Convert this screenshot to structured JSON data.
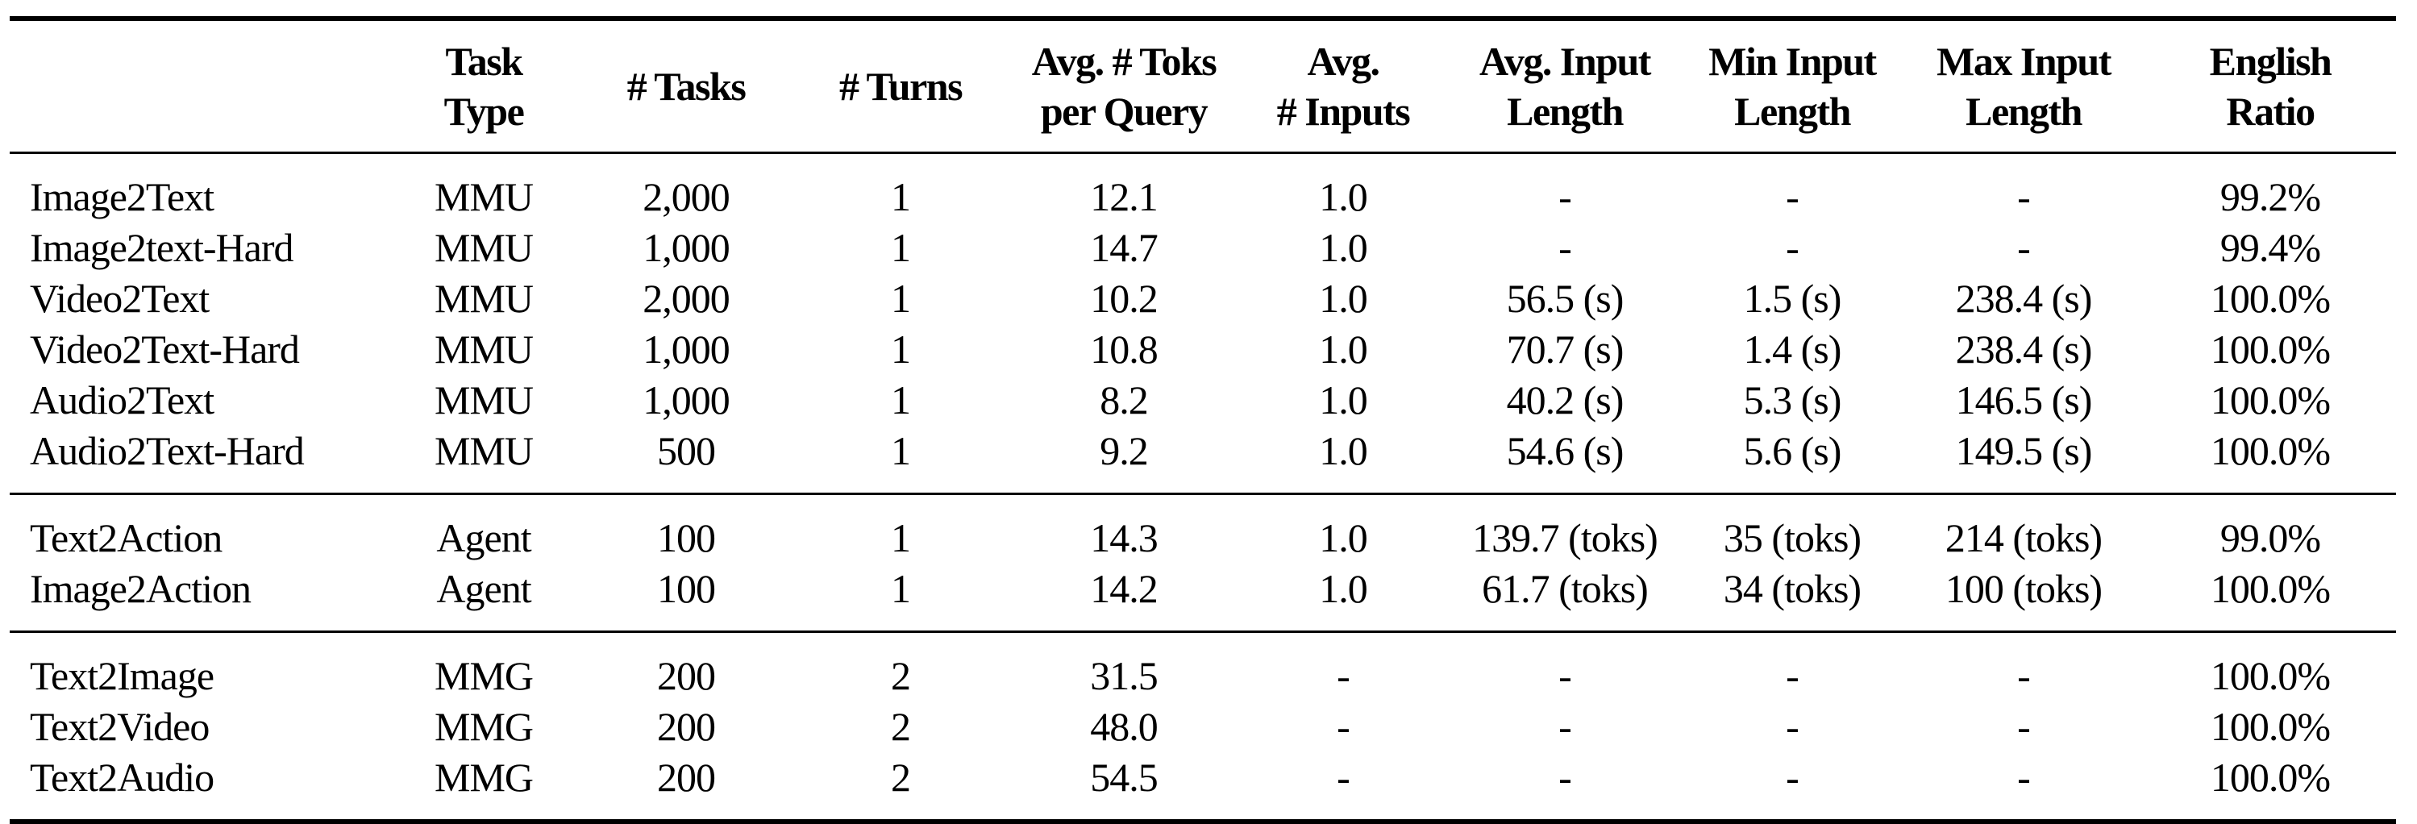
{
  "table": {
    "headers": [
      {
        "key": "name",
        "lines": [
          "",
          ""
        ]
      },
      {
        "key": "task_type",
        "lines": [
          "Task",
          "Type"
        ]
      },
      {
        "key": "num_tasks",
        "lines": [
          "# Tasks",
          ""
        ]
      },
      {
        "key": "num_turns",
        "lines": [
          "# Turns",
          ""
        ]
      },
      {
        "key": "avg_toks_per_query",
        "lines": [
          "Avg. # Toks",
          "per Query"
        ]
      },
      {
        "key": "avg_num_inputs",
        "lines": [
          "Avg.",
          "# Inputs"
        ]
      },
      {
        "key": "avg_input_length",
        "lines": [
          "Avg. Input",
          "Length"
        ]
      },
      {
        "key": "min_input_length",
        "lines": [
          "Min Input",
          "Length"
        ]
      },
      {
        "key": "max_input_length",
        "lines": [
          "Max Input",
          "Length"
        ]
      },
      {
        "key": "english_ratio",
        "lines": [
          "English",
          "Ratio"
        ]
      }
    ],
    "groups": [
      {
        "rows": [
          [
            "Image2Text",
            "MMU",
            "2,000",
            "1",
            "12.1",
            "1.0",
            "-",
            "-",
            "-",
            "99.2%"
          ],
          [
            "Image2text-Hard",
            "MMU",
            "1,000",
            "1",
            "14.7",
            "1.0",
            "-",
            "-",
            "-",
            "99.4%"
          ],
          [
            "Video2Text",
            "MMU",
            "2,000",
            "1",
            "10.2",
            "1.0",
            "56.5 (s)",
            "1.5 (s)",
            "238.4 (s)",
            "100.0%"
          ],
          [
            "Video2Text-Hard",
            "MMU",
            "1,000",
            "1",
            "10.8",
            "1.0",
            "70.7 (s)",
            "1.4 (s)",
            "238.4 (s)",
            "100.0%"
          ],
          [
            "Audio2Text",
            "MMU",
            "1,000",
            "1",
            "8.2",
            "1.0",
            "40.2 (s)",
            "5.3 (s)",
            "146.5 (s)",
            "100.0%"
          ],
          [
            "Audio2Text-Hard",
            "MMU",
            "500",
            "1",
            "9.2",
            "1.0",
            "54.6 (s)",
            "5.6 (s)",
            "149.5 (s)",
            "100.0%"
          ]
        ]
      },
      {
        "rows": [
          [
            "Text2Action",
            "Agent",
            "100",
            "1",
            "14.3",
            "1.0",
            "139.7 (toks)",
            "35 (toks)",
            "214 (toks)",
            "99.0%"
          ],
          [
            "Image2Action",
            "Agent",
            "100",
            "1",
            "14.2",
            "1.0",
            "61.7 (toks)",
            "34 (toks)",
            "100 (toks)",
            "100.0%"
          ]
        ]
      },
      {
        "rows": [
          [
            "Text2Image",
            "MMG",
            "200",
            "2",
            "31.5",
            "-",
            "-",
            "-",
            "-",
            "100.0%"
          ],
          [
            "Text2Video",
            "MMG",
            "200",
            "2",
            "48.0",
            "-",
            "-",
            "-",
            "-",
            "100.0%"
          ],
          [
            "Text2Audio",
            "MMG",
            "200",
            "2",
            "54.5",
            "-",
            "-",
            "-",
            "-",
            "100.0%"
          ]
        ]
      }
    ]
  }
}
